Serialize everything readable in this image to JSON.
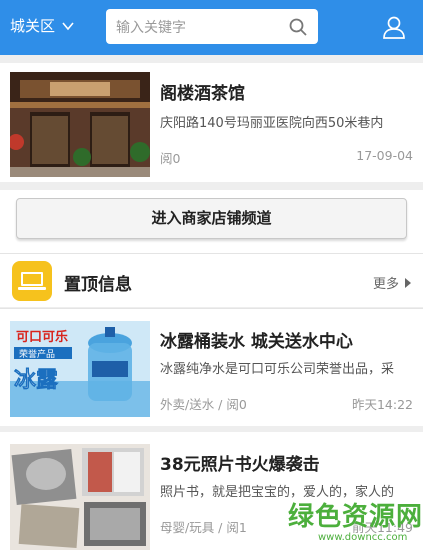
{
  "header": {
    "city": "城关区",
    "search_placeholder": "输入关键字"
  },
  "listings": [
    {
      "title": "阁楼酒茶馆",
      "desc": "庆阳路140号玛丽亚医院向西50米巷内",
      "meta": "阅0",
      "time": "17-09-04"
    }
  ],
  "channel_button": "进入商家店铺频道",
  "section": {
    "title": "置顶信息",
    "more": "更多"
  },
  "top_items": [
    {
      "title": "冰露桶装水 城关送水中心",
      "desc": "冰露纯净水是可口可乐公司荣誉出品，采",
      "meta": "外卖/送水 / 阅0",
      "time": "昨天14:22",
      "thumb_text": {
        "brand": "可口可乐",
        "sub": "荣誉产品",
        "big": "冰露"
      }
    },
    {
      "title": "38元照片书火爆袭击",
      "desc": "照片书，就是把宝宝的，爱人的，家人的",
      "meta": "母婴/玩具 / 阅1",
      "time": "前天11:49"
    }
  ],
  "watermark": {
    "text": "绿色资源网",
    "url": "www.downcc.com"
  },
  "colors": {
    "header": "#2f8ee8",
    "section_icon": "#f6c21d",
    "watermark": "#4caf3c"
  }
}
